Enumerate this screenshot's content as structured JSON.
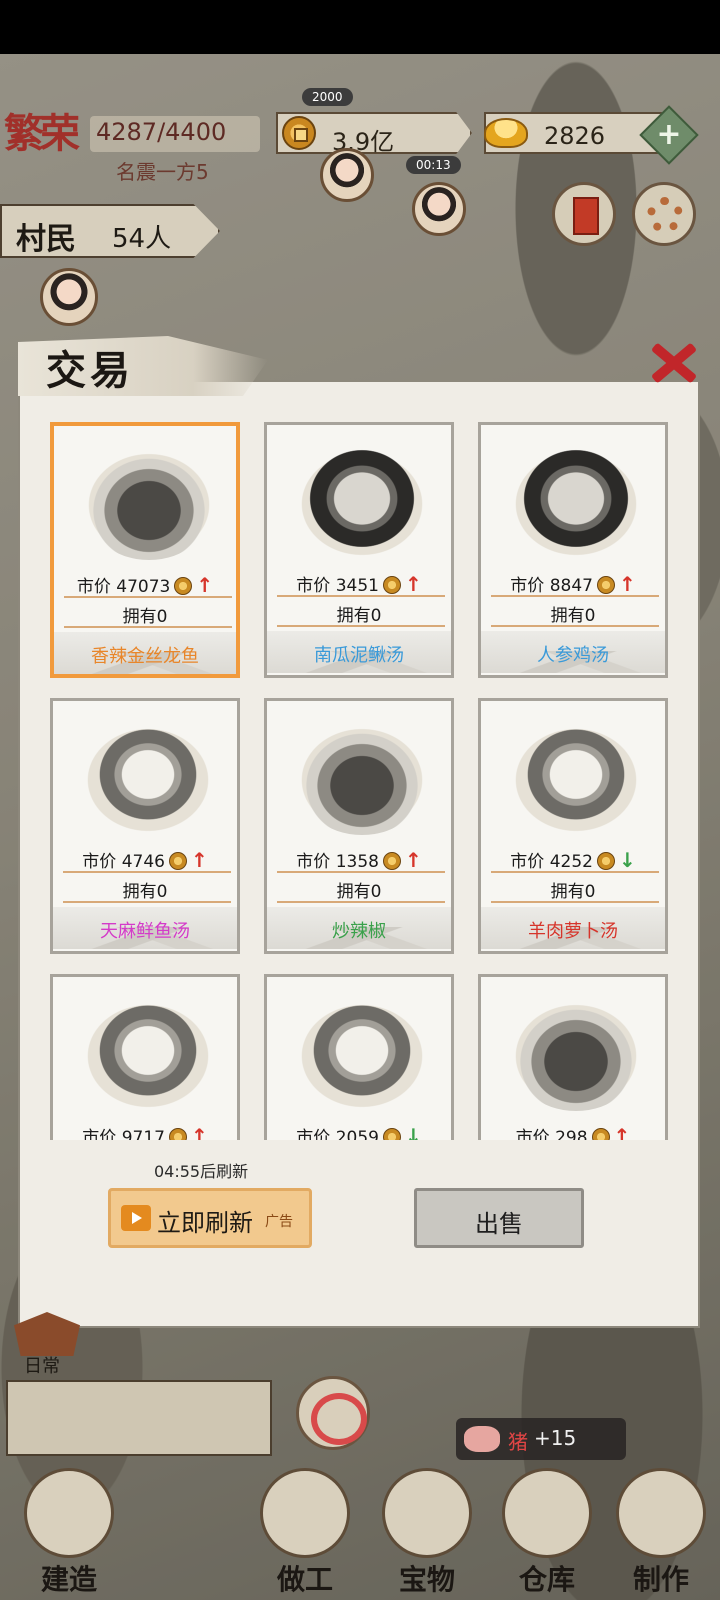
{
  "hud": {
    "prosperity_title": "繁荣",
    "prosperity_value": "4287/4400",
    "prosperity_rank": "名震一方5",
    "top_badge": "2000",
    "coins": "3.9亿",
    "ingots": "2826",
    "plus": "+",
    "timer_badge": "00:13",
    "villager_label": "村民",
    "villager_count": "54人"
  },
  "dialog": {
    "title": "交易",
    "refresh_timer": "04:55后刷新",
    "refresh_button": "立即刷新",
    "ad_tag": "广告",
    "sell_button": "出售",
    "price_label": "市价",
    "items": [
      {
        "name": "香辣金丝龙鱼",
        "price": "47073",
        "owned": "拥有0",
        "trend": "up",
        "name_color": "#e8862a"
      },
      {
        "name": "南瓜泥鳅汤",
        "price": "3451",
        "owned": "拥有0",
        "trend": "up",
        "name_color": "#3a9ad9"
      },
      {
        "name": "人参鸡汤",
        "price": "8847",
        "owned": "拥有0",
        "trend": "up",
        "name_color": "#3a9ad9"
      },
      {
        "name": "天麻鲜鱼汤",
        "price": "4746",
        "owned": "拥有0",
        "trend": "up",
        "name_color": "#d43bc9"
      },
      {
        "name": "炒辣椒",
        "price": "1358",
        "owned": "拥有0",
        "trend": "up",
        "name_color": "#3aa14b"
      },
      {
        "name": "羊肉萝卜汤",
        "price": "4252",
        "owned": "拥有0",
        "trend": "down",
        "name_color": "#d6352b"
      },
      {
        "name": "",
        "price": "9717",
        "owned": "",
        "trend": "up",
        "name_color": "#333333"
      },
      {
        "name": "",
        "price": "2059",
        "owned": "",
        "trend": "down",
        "name_color": "#333333"
      },
      {
        "name": "",
        "price": "298",
        "owned": "",
        "trend": "up",
        "name_color": "#333333"
      }
    ]
  },
  "bottom": {
    "daily_label": "日常",
    "pig_name": "猪",
    "pig_amount": "+15",
    "nav": [
      {
        "label": "建造"
      },
      {
        "label": "做工"
      },
      {
        "label": "宝物"
      },
      {
        "label": "仓库"
      },
      {
        "label": "制作"
      }
    ]
  }
}
